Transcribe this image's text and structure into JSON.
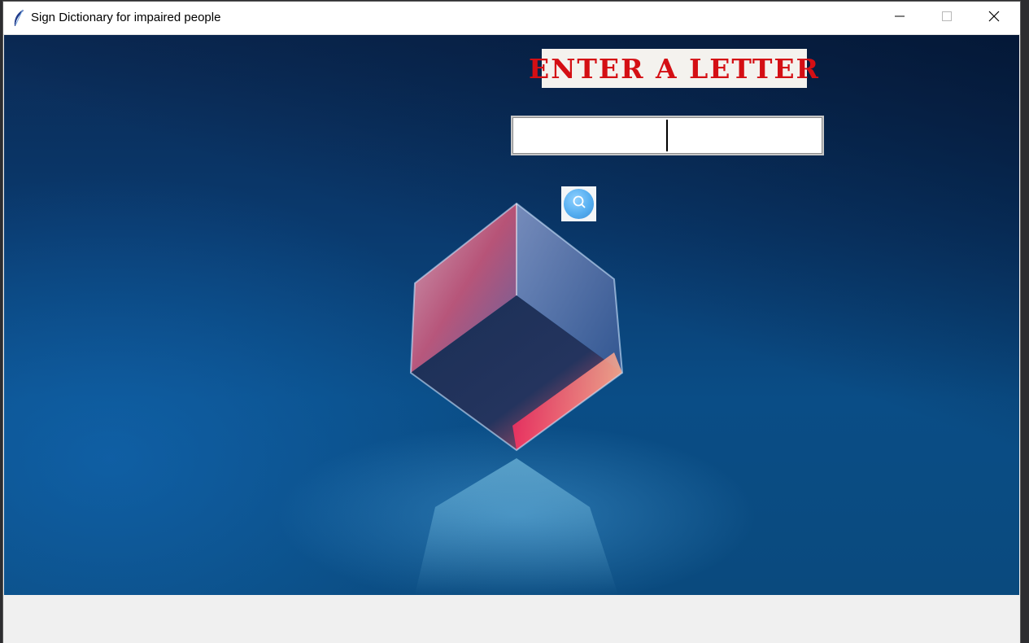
{
  "window": {
    "title": "Sign Dictionary for impaired people",
    "app_icon": "feather-icon",
    "controls": {
      "minimize_icon": "minimize-icon",
      "maximize_icon": "maximize-icon",
      "close_icon": "close-icon"
    }
  },
  "main": {
    "heading": "ENTER A LETTER",
    "heading_color": "#d40f14",
    "entry": {
      "value": "",
      "placeholder": ""
    },
    "search_button": {
      "icon": "search-icon",
      "color": "#55aef0"
    },
    "background": {
      "image": "glass-cube-on-blue-background",
      "color": "#0a4a7e"
    }
  }
}
